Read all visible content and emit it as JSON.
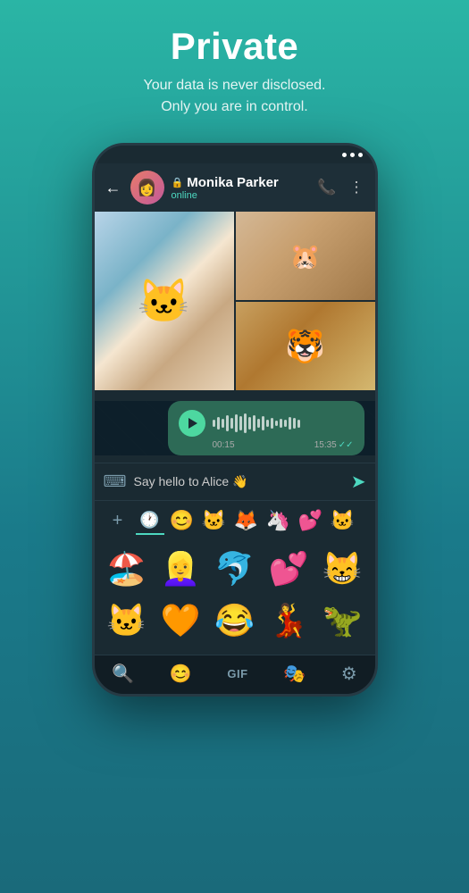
{
  "hero": {
    "title": "Private",
    "subtitle_line1": "Your data is never disclosed.",
    "subtitle_line2": "Only you are in control."
  },
  "chat_header": {
    "contact_name": "Monika Parker",
    "status": "online",
    "back_label": "←",
    "lock_icon": "🔒"
  },
  "voice_message": {
    "duration": "00:15",
    "time": "15:35",
    "double_check": "✓✓"
  },
  "input_bar": {
    "placeholder": "Say hello to Alice 👋",
    "keyboard_icon": "⌨",
    "send_icon": "➤"
  },
  "emoji_toolbar": {
    "add_icon": "+",
    "clock_icon": "🕐",
    "emojis": [
      "😊",
      "🐱",
      "🦊",
      "🦄",
      "💕",
      "🐱"
    ]
  },
  "stickers_row1": [
    "🌊🏖",
    "👱‍♀️",
    "🐬",
    "💕",
    "🐱"
  ],
  "stickers_row2": [
    "🐱",
    "🧡",
    "😂",
    "💃",
    "🦖"
  ],
  "bottom_nav": {
    "search": "🔍",
    "emoji": "😊",
    "gif": "GIF",
    "sticker": "🎭",
    "settings": "⚙"
  },
  "colors": {
    "accent": "#4dd8c0",
    "bg_dark": "#0d1f2a",
    "bubble_green": "#2d6a56"
  }
}
